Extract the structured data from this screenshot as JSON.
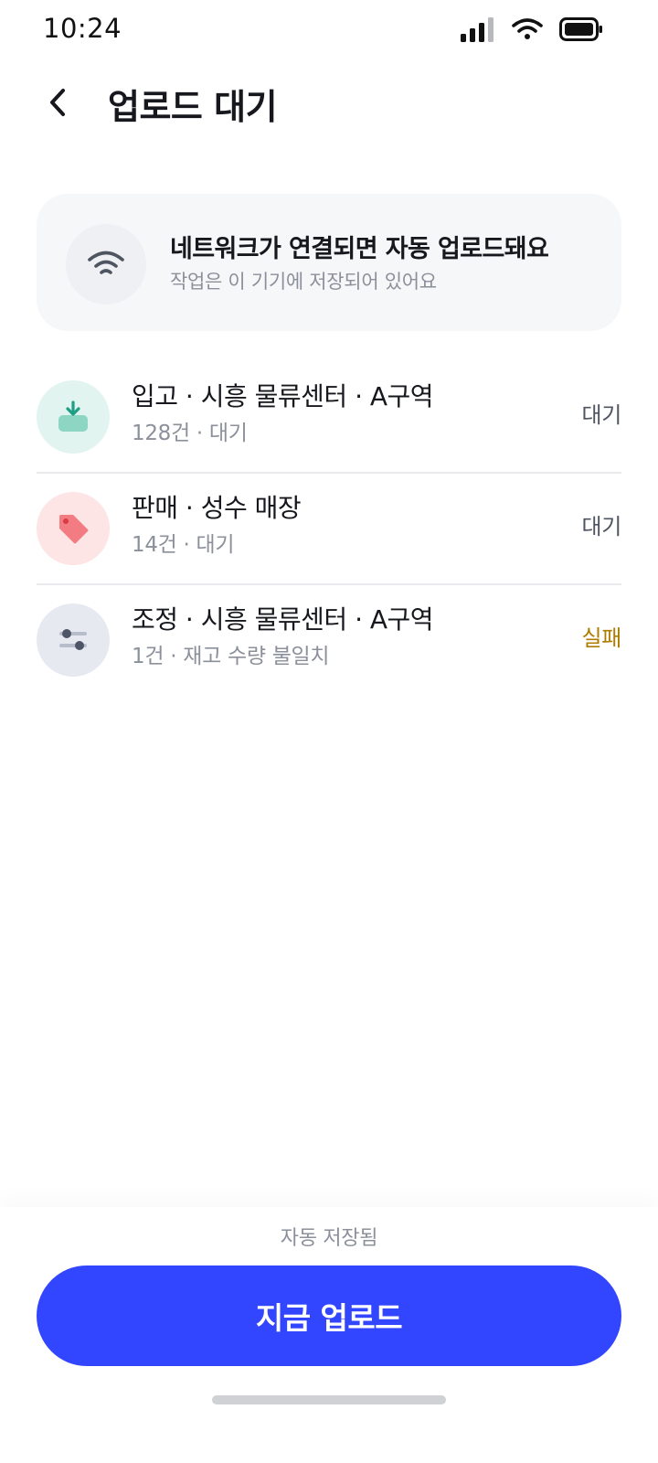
{
  "status_bar": {
    "time": "10:24",
    "icons": [
      "signal-icon",
      "wifi-icon",
      "battery-icon"
    ]
  },
  "header": {
    "back_icon": "chevron-left-icon",
    "title": "업로드 대기"
  },
  "banner": {
    "icon": "wifi-icon",
    "title": "네트워크가 연결되면 자동 업로드돼요",
    "subtitle": "작업은 이 기기에 저장되어 있어요"
  },
  "queue": [
    {
      "icon": "inbound-download-icon",
      "title": "입고 · 시흥 물류센터 · A구역",
      "subtitle": "128건 · 대기",
      "status": "대기"
    },
    {
      "icon": "price-tag-icon",
      "title": "판매 · 성수 매장",
      "subtitle": "14건 · 대기",
      "status": "대기"
    },
    {
      "icon": "adjust-sliders-icon",
      "title": "조정 · 시흥 물류센터 · A구역",
      "subtitle": "1건 · 재고 수량 불일치",
      "status": "실패"
    }
  ],
  "footer": {
    "autosave_text": "자동 저장됨",
    "upload_button": "지금 업로드"
  },
  "colors": {
    "primary": "#3346ff",
    "fail": "#b07c00",
    "inbound_bg": "#e2f4f0",
    "sales_bg": "#fde4e5",
    "adjust_bg": "#e7e9f0"
  }
}
